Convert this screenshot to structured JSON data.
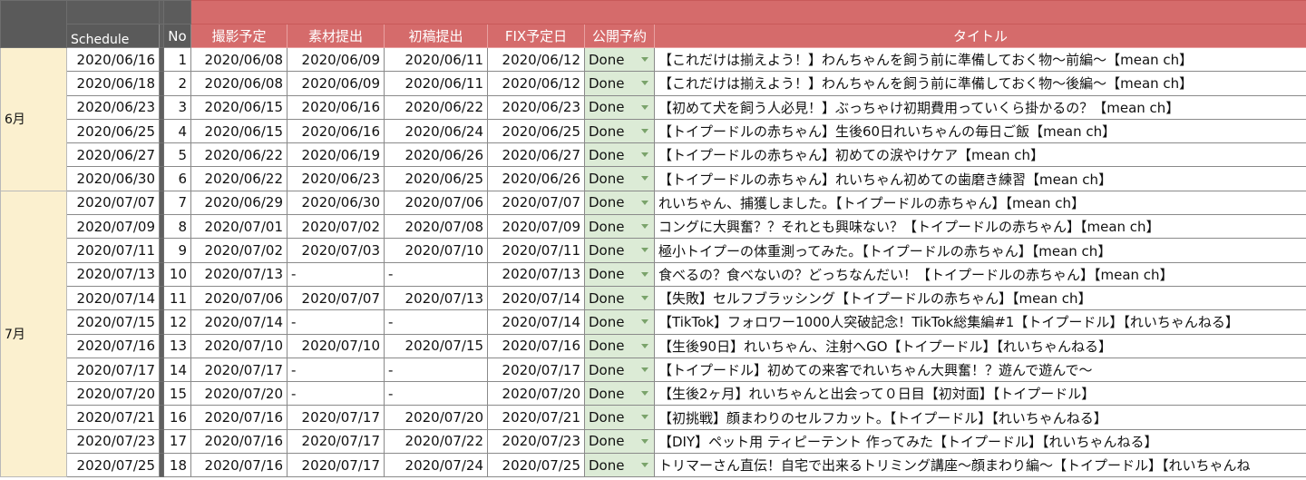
{
  "headers": {
    "schedule": "Schedule",
    "no": "No",
    "cols": [
      "撮影予定",
      "素材提出",
      "初稿提出",
      "FIX予定日",
      "公開予約",
      "タイトル"
    ]
  },
  "months": [
    {
      "label": "6月",
      "rows": 6
    },
    {
      "label": "7月",
      "rows": 12
    }
  ],
  "rows": [
    {
      "schedule": "2020/06/16",
      "no": "1",
      "shoot": "2020/06/08",
      "material": "2020/06/09",
      "draft": "2020/06/11",
      "fix": "2020/06/12",
      "status": "Done",
      "title": "【これだけは揃えよう！】わんちゃんを飼う前に準備しておく物〜前編〜【mean ch】"
    },
    {
      "schedule": "2020/06/18",
      "no": "2",
      "shoot": "2020/06/08",
      "material": "2020/06/09",
      "draft": "2020/06/11",
      "fix": "2020/06/12",
      "status": "Done",
      "title": "【これだけは揃えよう！】わんちゃんを飼う前に準備しておく物〜後編〜【mean ch】"
    },
    {
      "schedule": "2020/06/23",
      "no": "3",
      "shoot": "2020/06/15",
      "material": "2020/06/16",
      "draft": "2020/06/22",
      "fix": "2020/06/23",
      "status": "Done",
      "title": "【初めて犬を飼う人必見！】ぶっちゃけ初期費用っていくら掛かるの？【mean ch】"
    },
    {
      "schedule": "2020/06/25",
      "no": "4",
      "shoot": "2020/06/15",
      "material": "2020/06/16",
      "draft": "2020/06/24",
      "fix": "2020/06/25",
      "status": "Done",
      "title": "【トイプードルの赤ちゃん】生後60日れいちゃんの毎日ご飯【mean ch】"
    },
    {
      "schedule": "2020/06/27",
      "no": "5",
      "shoot": "2020/06/22",
      "material": "2020/06/19",
      "draft": "2020/06/26",
      "fix": "2020/06/27",
      "status": "Done",
      "title": "【トイプードルの赤ちゃん】初めての涙やけケア【mean ch】"
    },
    {
      "schedule": "2020/06/30",
      "no": "6",
      "shoot": "2020/06/22",
      "material": "2020/06/23",
      "draft": "2020/06/25",
      "fix": "2020/06/26",
      "status": "Done",
      "title": "【トイプードルの赤ちゃん】れいちゃん初めての歯磨き練習【mean ch】"
    },
    {
      "schedule": "2020/07/07",
      "no": "7",
      "shoot": "2020/06/29",
      "material": "2020/06/30",
      "draft": "2020/07/06",
      "fix": "2020/07/07",
      "status": "Done",
      "title": "れいちゃん、捕獲しました。【トイプードルの赤ちゃん】【mean ch】"
    },
    {
      "schedule": "2020/07/09",
      "no": "8",
      "shoot": "2020/07/01",
      "material": "2020/07/02",
      "draft": "2020/07/08",
      "fix": "2020/07/09",
      "status": "Done",
      "title": "コングに大興奮？？それとも興味ない？【トイプードルの赤ちゃん】【mean ch】"
    },
    {
      "schedule": "2020/07/11",
      "no": "9",
      "shoot": "2020/07/02",
      "material": "2020/07/03",
      "draft": "2020/07/10",
      "fix": "2020/07/11",
      "status": "Done",
      "title": "極小トイプーの体重測ってみた。【トイプードルの赤ちゃん】【mean ch】"
    },
    {
      "schedule": "2020/07/13",
      "no": "10",
      "shoot": "2020/07/13",
      "material": "-",
      "draft": "-",
      "fix": "2020/07/13",
      "status": "Done",
      "title": "食べるの？食べないの？どっちなんだい！【トイプードルの赤ちゃん】【mean ch】"
    },
    {
      "schedule": "2020/07/14",
      "no": "11",
      "shoot": "2020/07/06",
      "material": "2020/07/07",
      "draft": "2020/07/13",
      "fix": "2020/07/14",
      "status": "Done",
      "title": "【失敗】セルフブラッシング【トイプードルの赤ちゃん】【mean ch】"
    },
    {
      "schedule": "2020/07/15",
      "no": "12",
      "shoot": "2020/07/14",
      "material": "-",
      "draft": "-",
      "fix": "2020/07/14",
      "status": "Done",
      "title": "【TikTok】フォロワー1000人突破記念！TikTok総集編#1【トイプードル】【れいちゃんねる】"
    },
    {
      "schedule": "2020/07/16",
      "no": "13",
      "shoot": "2020/07/10",
      "material": "2020/07/10",
      "draft": "2020/07/15",
      "fix": "2020/07/16",
      "status": "Done",
      "title": "【生後90日】れいちゃん、注射へGO【トイプードル】【れいちゃんねる】"
    },
    {
      "schedule": "2020/07/17",
      "no": "14",
      "shoot": "2020/07/17",
      "material": "-",
      "draft": "-",
      "fix": "2020/07/17",
      "status": "Done",
      "title": "【トイプードル】初めての来客でれいちゃん大興奮！？遊んで遊んで〜"
    },
    {
      "schedule": "2020/07/20",
      "no": "15",
      "shoot": "2020/07/20",
      "material": "-",
      "draft": "-",
      "fix": "2020/07/20",
      "status": "Done",
      "title": "【生後2ヶ月】れいちゃんと出会って０日目【初対面】【トイプードル】"
    },
    {
      "schedule": "2020/07/21",
      "no": "16",
      "shoot": "2020/07/16",
      "material": "2020/07/17",
      "draft": "2020/07/20",
      "fix": "2020/07/21",
      "status": "Done",
      "title": "【初挑戦】顔まわりのセルフカット。【トイプードル】【れいちゃんねる】"
    },
    {
      "schedule": "2020/07/23",
      "no": "17",
      "shoot": "2020/07/16",
      "material": "2020/07/17",
      "draft": "2020/07/22",
      "fix": "2020/07/23",
      "status": "Done",
      "title": "【DIY】ペット用 ティピーテント 作ってみた【トイプードル】【れいちゃんねる】"
    },
    {
      "schedule": "2020/07/25",
      "no": "18",
      "shoot": "2020/07/16",
      "material": "2020/07/17",
      "draft": "2020/07/24",
      "fix": "2020/07/25",
      "status": "Done",
      "title": "トリマーさん直伝！自宅で出来るトリミング講座〜顔まわり編〜【トイプードル】【れいちゃんね"
    }
  ]
}
